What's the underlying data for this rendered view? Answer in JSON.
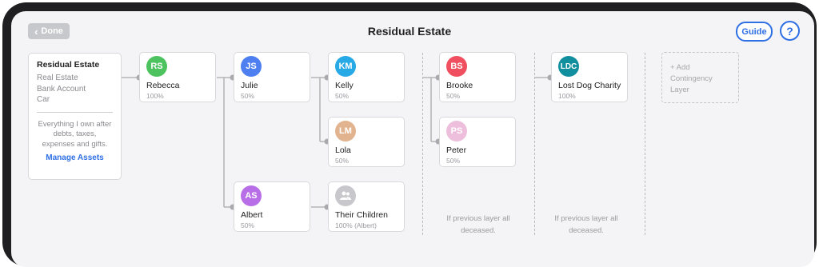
{
  "header": {
    "done_label": "Done",
    "title": "Residual Estate",
    "guide_label": "Guide",
    "help_label": "?"
  },
  "asset_card": {
    "heading": "Residual Estate",
    "items": [
      "Real Estate",
      "Bank Account",
      "Car"
    ],
    "description": "Everything I own after debts, taxes, expenses and gifts.",
    "manage_label": "Manage Assets"
  },
  "beneficiaries": {
    "rebecca": {
      "initials": "RS",
      "name": "Rebecca",
      "share": "100%",
      "color": "#4cc35f"
    },
    "julie": {
      "initials": "JS",
      "name": "Julie",
      "share": "50%",
      "color": "#4d7ff0"
    },
    "albert": {
      "initials": "AS",
      "name": "Albert",
      "share": "50%",
      "color": "#b86ee6"
    },
    "kelly": {
      "initials": "KM",
      "name": "Kelly",
      "share": "50%",
      "color": "#27a9e6"
    },
    "lola": {
      "initials": "LM",
      "name": "Lola",
      "share": "50%",
      "color": "#e2b38f"
    },
    "children": {
      "icon": "people-icon",
      "name": "Their Children",
      "share": "100% (Albert)",
      "color": "#c8c8cc"
    },
    "brooke": {
      "initials": "BS",
      "name": "Brooke",
      "share": "50%",
      "color": "#ef4f5f"
    },
    "peter": {
      "initials": "PS",
      "name": "Peter",
      "share": "50%",
      "color": "#edbfdc"
    },
    "charity": {
      "initials": "LDC",
      "name": "Lost Dog Charity",
      "share": "100%",
      "color": "#128f9e"
    }
  },
  "add_layer_label": "+ Add\nContingency\nLayer",
  "notes": {
    "layer1": "If previous layer all deceased.",
    "layer2": "If previous layer all deceased."
  },
  "colors": {
    "accent": "#2f6fe4",
    "connector": "#a9a9ae"
  }
}
